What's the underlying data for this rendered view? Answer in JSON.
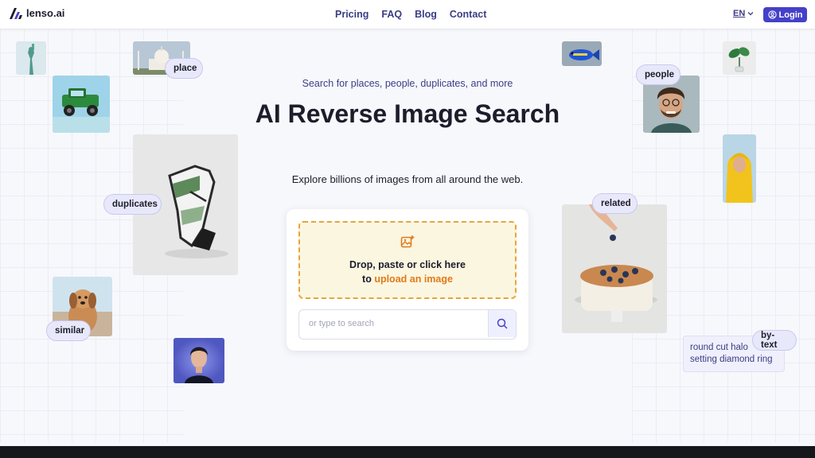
{
  "brand": {
    "name": "lenso.ai"
  },
  "nav": [
    {
      "label": "Pricing"
    },
    {
      "label": "FAQ"
    },
    {
      "label": "Blog"
    },
    {
      "label": "Contact"
    }
  ],
  "header": {
    "language": "EN",
    "login_label": "Login"
  },
  "hero": {
    "eyebrow": "Search for places, people, duplicates, and more",
    "title": "AI Reverse Image Search",
    "subtitle": "Explore billions of images from all around the web."
  },
  "upload": {
    "line1": "Drop, paste or click here",
    "line2_prefix": "to ",
    "line2_link": "upload an image",
    "icon": "image-plus-icon"
  },
  "search": {
    "placeholder": "or type to search",
    "icon": "search-icon"
  },
  "tags": {
    "place": "place",
    "duplicates": "duplicates",
    "similar": "similar",
    "people": "people",
    "related": "related",
    "by_text": "by-text"
  },
  "text_sample": {
    "line1": "round cut halo",
    "line2": "setting diamond ring"
  },
  "colors": {
    "accent": "#4540c9",
    "link": "#e07a1a",
    "tag_bg": "#e8e8fb",
    "dropzone_bg": "#fbf6e0"
  }
}
